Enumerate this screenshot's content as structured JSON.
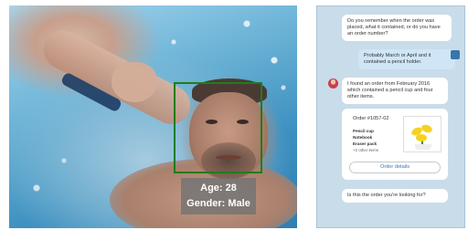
{
  "photo": {
    "face_label": {
      "age": "Age: 28",
      "gender": "Gender: Male"
    },
    "box_color": "#1f7d1b"
  },
  "chat": {
    "bot_question": "Do you remember when the order was placed, what it contained, or do you have an order number?",
    "user_reply": "Probably March or April and it contained a pencil holder.",
    "bot_found": "I found an order from February 2016 which contained a pencil cup and four other items.",
    "order": {
      "title": "Order #1057-02",
      "items": [
        "Pencil cup",
        "Notebook",
        "Eraser pack"
      ],
      "more": "+2 other items",
      "button": "Order details"
    },
    "bot_confirm": "Is this the order you're looking for?",
    "accent": "#3576b6"
  },
  "icons": [
    "user-avatar-icon",
    "bot-avatar-icon",
    "product-thumbnail"
  ]
}
